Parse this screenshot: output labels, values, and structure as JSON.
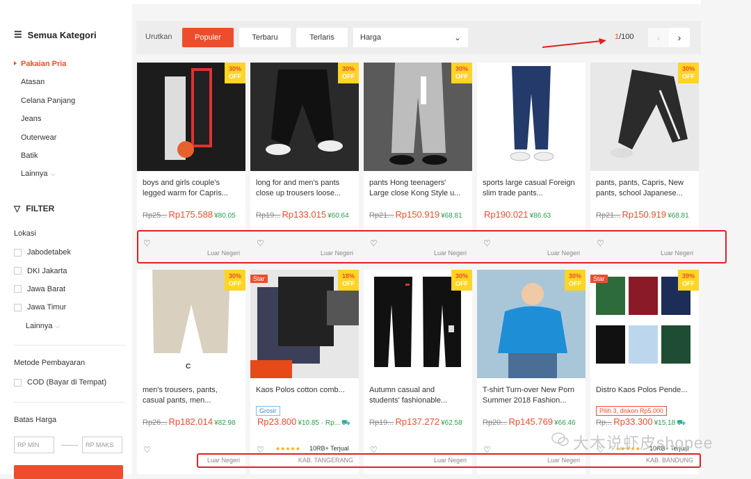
{
  "sidebar": {
    "category_title": "Semua Kategori",
    "categories": [
      {
        "label": "Pakaian Pria"
      },
      {
        "label": "Atasan"
      },
      {
        "label": "Celana Panjang"
      },
      {
        "label": "Jeans"
      },
      {
        "label": "Outerwear"
      },
      {
        "label": "Batik"
      },
      {
        "label": "Lainnya"
      }
    ],
    "filter_title": "FILTER",
    "lokasi_title": "Lokasi",
    "lokasi": [
      "Jabodetabek",
      "DKI Jakarta",
      "Jawa Barat",
      "Jawa Timur"
    ],
    "lokasi_more": "Lainnya",
    "payment_title": "Metode Pembayaran",
    "payment_options": [
      "COD (Bayar di Tempat)"
    ],
    "price_title": "Batas Harga",
    "price_min_placeholder": "RP MIN",
    "price_max_placeholder": "RP MAKS"
  },
  "sortbar": {
    "label": "Urutkan",
    "buttons": [
      "Populer",
      "Terbaru",
      "Terlaris"
    ],
    "select_value": "Harga",
    "page_current": "1",
    "page_total": "/100",
    "prev": "‹",
    "next": "›"
  },
  "products": [
    {
      "name": "boys and girls couple's legged warm for Capris...",
      "old": "Rp25...",
      "price": "Rp175.588",
      "yen": "¥80.05",
      "discount": "30%",
      "off": "OFF",
      "loc": "Luar Negeri"
    },
    {
      "name": "long for and men's pants close up trousers loose...",
      "old": "Rp19...",
      "price": "Rp133.015",
      "yen": "¥60.64",
      "discount": "30%",
      "off": "OFF",
      "loc": "Luar Negeri"
    },
    {
      "name": "pants Hong teenagers' Large close Kong Style u...",
      "old": "Rp21...",
      "price": "Rp150.919",
      "yen": "¥68.81",
      "discount": "30%",
      "off": "OFF",
      "loc": "Luar Negeri"
    },
    {
      "name": "sports large casual Foreign slim trade pants...",
      "old": "",
      "price": "Rp190.021",
      "yen": "¥86.63",
      "discount": "",
      "off": "",
      "loc": "Luar Negeri"
    },
    {
      "name": "pants, pants, Capris, New pants, school Japanese...",
      "old": "Rp21...",
      "price": "Rp150.919",
      "yen": "¥68.81",
      "discount": "30%",
      "off": "OFF",
      "loc": "Luar Negeri"
    },
    {
      "name": "men's trousers, pants, casual pants, men...",
      "old": "Rp26...",
      "price": "Rp182.014",
      "yen": "¥82.98",
      "discount": "30%",
      "off": "OFF",
      "loc": "Luar Negeri"
    },
    {
      "name": "Kaos Polos cotton comb...",
      "old": "",
      "price": "Rp23.800",
      "yen": "¥10.85 · Rp...",
      "discount": "18%",
      "off": "OFF",
      "loc": "KAB. TANGERANG",
      "star": "Star",
      "tag": "Grosir",
      "rating": "★★★★★",
      "sold": "10RB+ Terjual"
    },
    {
      "name": "Autumn casual and students' fashionable...",
      "old": "Rp19...",
      "price": "Rp137.272",
      "yen": "¥62.58",
      "discount": "30%",
      "off": "OFF",
      "loc": "Luar Negeri"
    },
    {
      "name": "T-shirt Turn-over New Porn Summer 2018 Fashion...",
      "old": "Rp20...",
      "price": "Rp145.769",
      "yen": "¥66.46",
      "discount": "30%",
      "off": "OFF",
      "loc": "Luar Negeri"
    },
    {
      "name": "Distro Kaos Polos Pende...",
      "old": "Rp...",
      "price": "Rp33.300",
      "yen": "¥15.18",
      "discount": "39%",
      "off": "OFF",
      "loc": "KAB. BANDUNG",
      "star": "Star",
      "tag": "Pilih 3, diskon Rp5.000",
      "rating": "★★★★★",
      "sold": "10RB+ Terjual"
    }
  ],
  "watermark": "大木说虾皮shopee",
  "colors": {
    "accent": "#ee4d2d",
    "highlight": "#e02020",
    "discount_badge": "#ffd424"
  }
}
